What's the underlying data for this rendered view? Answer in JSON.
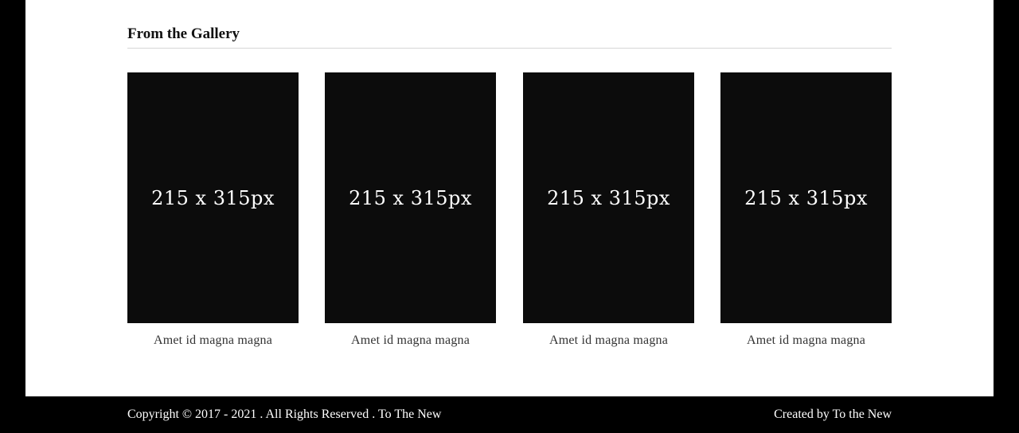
{
  "gallery": {
    "title": "From the Gallery",
    "items": [
      {
        "placeholder": "215 x 315px",
        "caption": "Amet id magna magna"
      },
      {
        "placeholder": "215 x 315px",
        "caption": "Amet id magna magna"
      },
      {
        "placeholder": "215 x 315px",
        "caption": "Amet id magna magna"
      },
      {
        "placeholder": "215 x 315px",
        "caption": "Amet id magna magna"
      }
    ]
  },
  "footer": {
    "copyright": "Copyright © 2017 - 2021 . All Rights Reserved . To The New",
    "credit": "Created by To the New"
  },
  "colors": {
    "page_background": "#000000",
    "content_background": "#ffffff",
    "thumbnail_background": "#0c0c0c",
    "divider": "#d6d6d6"
  }
}
